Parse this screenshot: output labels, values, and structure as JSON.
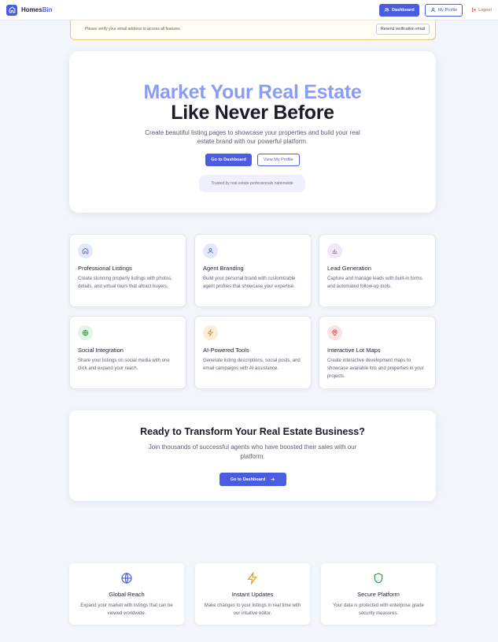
{
  "header": {
    "brand_prefix": "Homes",
    "brand_accent": "Bin",
    "dashboard_label": "Dashboard",
    "profile_label": "My Profile",
    "logout_label": "Logout"
  },
  "banner": {
    "message": "Please verify your email address to access all features.",
    "button_label": "Resend verification email"
  },
  "hero": {
    "title_line1": "Market Your Real Estate",
    "title_line2": "Like Never Before",
    "subtitle": "Create beautiful listing pages to showcase your properties and build your real estate brand with our powerful platform.",
    "primary_button": "Go to Dashboard",
    "secondary_button": "View My Profile",
    "trust_text": "Trusted by real estate professionals nationwide"
  },
  "features": [
    {
      "icon": "home-icon",
      "title": "Professional Listings",
      "description": "Create stunning property listings with photos, details, and virtual tours that attract buyers."
    },
    {
      "icon": "user-icon",
      "title": "Agent Branding",
      "description": "Build your personal brand with customizable agent profiles that showcase your expertise."
    },
    {
      "icon": "bar-chart-icon",
      "title": "Lead Generation",
      "description": "Capture and manage leads with built-in forms and automated follow-up tools."
    },
    {
      "icon": "globe-icon",
      "title": "Social Integration",
      "description": "Share your listings on social media with one click and expand your reach."
    },
    {
      "icon": "lightning-icon",
      "title": "AI-Powered Tools",
      "description": "Generate listing descriptions, social posts, and email campaigns with AI assistance."
    },
    {
      "icon": "map-pin-icon",
      "title": "Interactive Lot Maps",
      "description": "Create interactive development maps to showcase available lots and properties in your projects."
    }
  ],
  "cta": {
    "title": "Ready to Transform Your Real Estate Business?",
    "subtitle": "Join thousands of successful agents who have boosted their sales with our platform.",
    "button_label": "Go to Dashboard"
  },
  "benefits": [
    {
      "icon": "globe-icon",
      "title": "Global Reach",
      "description": "Expand your market with listings that can be viewed worldwide."
    },
    {
      "icon": "lightning-icon",
      "title": "Instant Updates",
      "description": "Make changes to your listings in real time with our intuitive editor."
    },
    {
      "icon": "shield-icon",
      "title": "Secure Platform",
      "description": "Your data is protected with enterprise grade security measures."
    }
  ],
  "colors": {
    "brand": "#4a5de0",
    "hero_accent": "#8a9cf4",
    "logout": "#d84a3a",
    "banner_border": "#e9c86a"
  }
}
